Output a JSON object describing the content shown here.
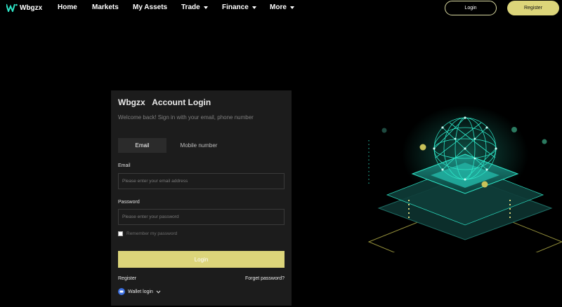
{
  "brand": {
    "name": "Wbgzx",
    "accent": "#2ee6c8"
  },
  "nav": {
    "items": [
      {
        "label": "Home",
        "dropdown": false
      },
      {
        "label": "Markets",
        "dropdown": false
      },
      {
        "label": "My Assets",
        "dropdown": false
      },
      {
        "label": "Trade",
        "dropdown": true
      },
      {
        "label": "Finance",
        "dropdown": true
      },
      {
        "label": "More",
        "dropdown": true
      }
    ],
    "login_label": "Login",
    "register_label": "Register"
  },
  "login": {
    "title": "Wbgzx   Account Login",
    "subtitle": "Welcome back! Sign in with your email, phone number",
    "tabs": [
      {
        "label": "Email",
        "active": true
      },
      {
        "label": "Mobile number",
        "active": false
      }
    ],
    "email_label": "Email",
    "email_placeholder": "Please enter your email address",
    "password_label": "Password",
    "password_placeholder": "Please enter your password",
    "remember_label": "Remember my password",
    "remember_checked": false,
    "submit_label": "Login",
    "register_link": "Register",
    "forgot_link": "Forget password?",
    "wallet_label": "Wallet login"
  },
  "colors": {
    "primary_button": "#dcd57a",
    "card_bg": "#1c1c1c",
    "page_bg": "#000000",
    "illustration_teal": "#2ee6c8"
  },
  "icons": {
    "logo": "wbgzx-logo-icon",
    "dropdown": "caret-down-icon",
    "wallet": "wallet-circle-icon",
    "wallet_caret": "chevron-down-icon"
  }
}
